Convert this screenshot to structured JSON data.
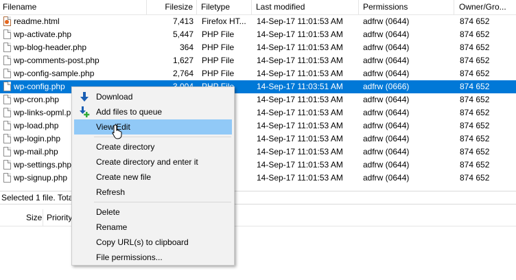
{
  "columns": [
    "Filename",
    "Filesize",
    "Filetype",
    "Last modified",
    "Permissions",
    "Owner/Gro..."
  ],
  "files": [
    {
      "name": "readme.html",
      "size": "7,413",
      "type": "Firefox HT...",
      "modified": "14-Sep-17 11:01:53 AM",
      "perms": "adfrw (0644)",
      "owner": "874 652",
      "icon": "html-file-icon"
    },
    {
      "name": "wp-activate.php",
      "size": "5,447",
      "type": "PHP File",
      "modified": "14-Sep-17 11:01:53 AM",
      "perms": "adfrw (0644)",
      "owner": "874 652",
      "icon": "file-icon"
    },
    {
      "name": "wp-blog-header.php",
      "size": "364",
      "type": "PHP File",
      "modified": "14-Sep-17 11:01:53 AM",
      "perms": "adfrw (0644)",
      "owner": "874 652",
      "icon": "file-icon"
    },
    {
      "name": "wp-comments-post.php",
      "size": "1,627",
      "type": "PHP File",
      "modified": "14-Sep-17 11:01:53 AM",
      "perms": "adfrw (0644)",
      "owner": "874 652",
      "icon": "file-icon"
    },
    {
      "name": "wp-config-sample.php",
      "size": "2,764",
      "type": "PHP File",
      "modified": "14-Sep-17 11:01:53 AM",
      "perms": "adfrw (0644)",
      "owner": "874 652",
      "icon": "file-icon"
    },
    {
      "name": "wp-config.php",
      "size": "3,004",
      "type": "PHP File",
      "modified": "14-Sep-17 11:03:51 AM",
      "perms": "adfrw (0666)",
      "owner": "874 652",
      "icon": "file-icon",
      "selected": true
    },
    {
      "name": "wp-cron.php",
      "size": "",
      "type": "",
      "modified": "14-Sep-17 11:01:53 AM",
      "perms": "adfrw (0644)",
      "owner": "874 652",
      "icon": "file-icon"
    },
    {
      "name": "wp-links-opml.php",
      "size": "",
      "type": "",
      "modified": "14-Sep-17 11:01:53 AM",
      "perms": "adfrw (0644)",
      "owner": "874 652",
      "icon": "file-icon"
    },
    {
      "name": "wp-load.php",
      "size": "",
      "type": "",
      "modified": "14-Sep-17 11:01:53 AM",
      "perms": "adfrw (0644)",
      "owner": "874 652",
      "icon": "file-icon"
    },
    {
      "name": "wp-login.php",
      "size": "",
      "type": "",
      "modified": "14-Sep-17 11:01:53 AM",
      "perms": "adfrw (0644)",
      "owner": "874 652",
      "icon": "file-icon"
    },
    {
      "name": "wp-mail.php",
      "size": "",
      "type": "",
      "modified": "14-Sep-17 11:01:53 AM",
      "perms": "adfrw (0644)",
      "owner": "874 652",
      "icon": "file-icon"
    },
    {
      "name": "wp-settings.php",
      "size": "",
      "type": "",
      "modified": "14-Sep-17 11:01:53 AM",
      "perms": "adfrw (0644)",
      "owner": "874 652",
      "icon": "file-icon"
    },
    {
      "name": "wp-signup.php",
      "size": "",
      "type": "",
      "modified": "14-Sep-17 11:01:53 AM",
      "perms": "adfrw (0644)",
      "owner": "874 652",
      "icon": "file-icon"
    }
  ],
  "status_text": "Selected 1 file. Total",
  "queue_columns": [
    "Size",
    "Priority"
  ],
  "context_menu": {
    "items": [
      "Download",
      "Add files to queue",
      "View/Edit",
      "Create directory",
      "Create directory and enter it",
      "Create new file",
      "Refresh",
      "Delete",
      "Rename",
      "Copy URL(s) to clipboard",
      "File permissions..."
    ],
    "highlighted": "View/Edit"
  },
  "colors": {
    "selection": "#0078d7",
    "menu_highlight": "#91c9f7",
    "menu_bg": "#f2f2f2"
  }
}
